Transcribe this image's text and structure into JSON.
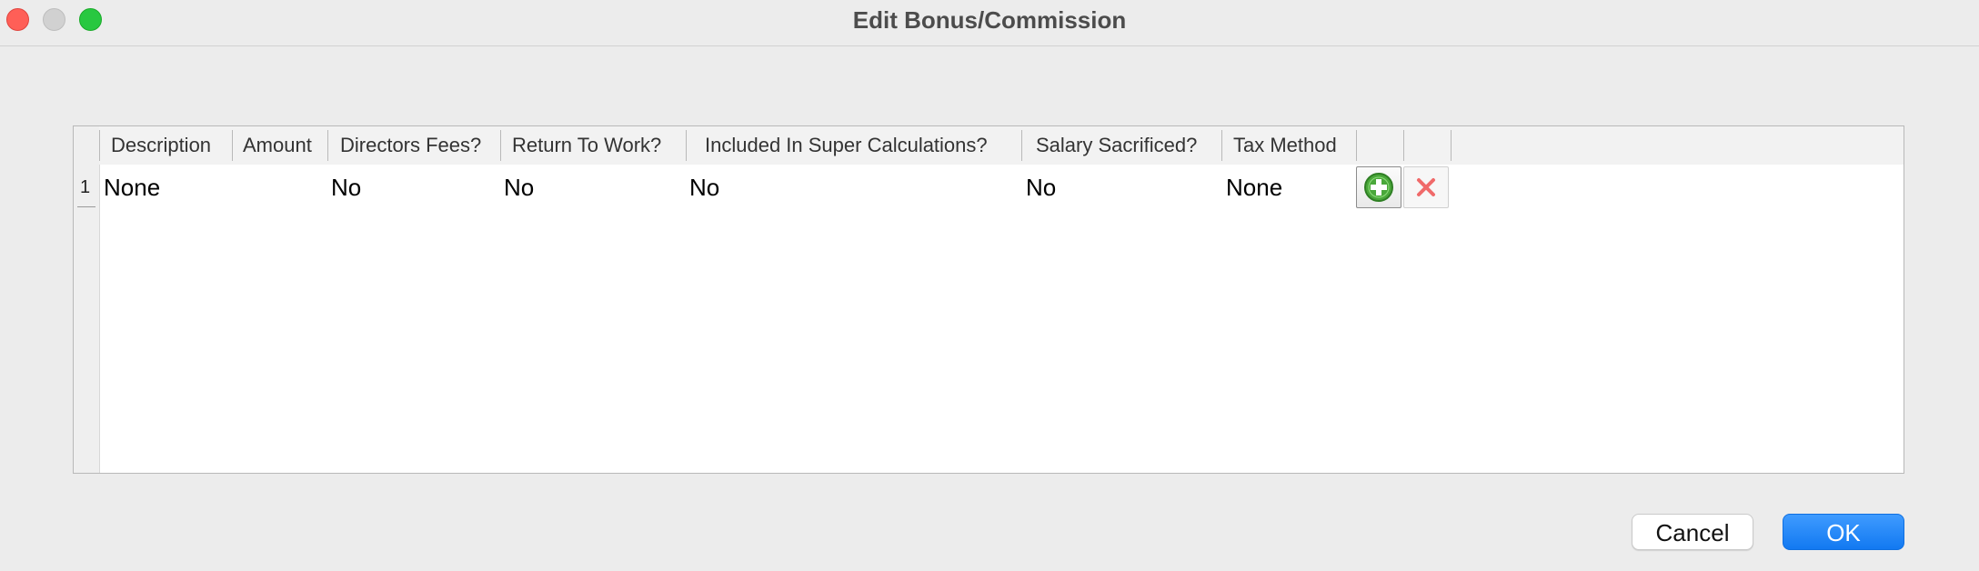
{
  "window": {
    "title": "Edit Bonus/Commission"
  },
  "table": {
    "columns": [
      "Description",
      "Amount",
      "Directors Fees?",
      "Return To Work?",
      "Included In Super Calculations?",
      "Salary Sacrificed?",
      "Tax Method"
    ],
    "rows": [
      {
        "number": "1",
        "description": "None",
        "amount": "",
        "directors_fees": "No",
        "return_to_work": "No",
        "included_in_super": "No",
        "salary_sacrificed": "No",
        "tax_method": "None"
      }
    ],
    "icons": {
      "add": "add-circle-icon",
      "delete": "delete-x-icon"
    }
  },
  "footer": {
    "cancel_label": "Cancel",
    "ok_label": "OK"
  },
  "colors": {
    "close": "#ff5f57",
    "minimize": "#d1d1d1",
    "maximize": "#28c840",
    "add_icon_green": "#4aa83a",
    "delete_icon_red": "#f06a6a",
    "ok_button_blue": "#1a7ff3"
  }
}
